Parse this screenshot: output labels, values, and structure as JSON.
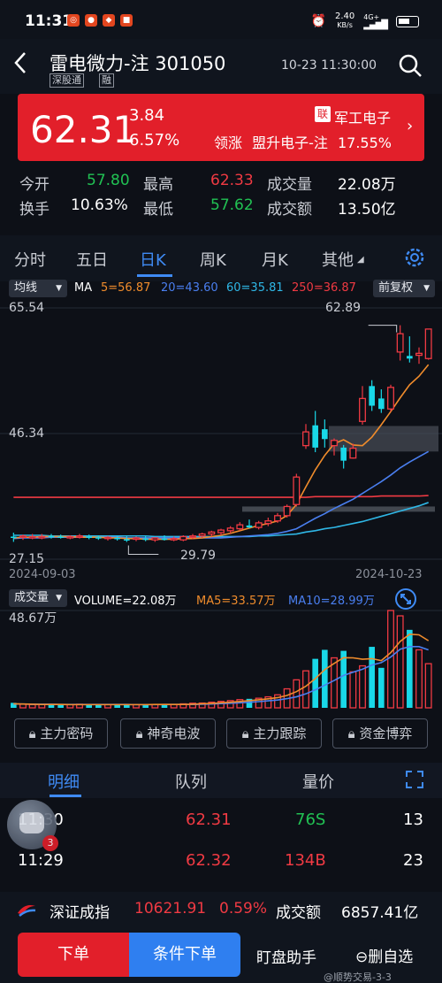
{
  "status": {
    "time": "11:31",
    "net_speed": "2.40",
    "net_unit": "KB/s",
    "net_type": "4G+"
  },
  "header": {
    "title": "雷电微力-注 301050",
    "tag1": "深股通",
    "tag2": "融",
    "datetime": "10-23 11:30:00"
  },
  "quote": {
    "price": "62.31",
    "change": "3.84",
    "change_pct": "6.57%",
    "lian": "联",
    "sector": "军工电子",
    "leader_label": "领涨",
    "leader_name": "盟升电子-注",
    "leader_pct": "17.55%"
  },
  "stats": {
    "open_label": "今开",
    "open": "57.80",
    "high_label": "最高",
    "high": "62.33",
    "vol_label": "成交量",
    "vol": "22.08万",
    "turnover_label": "换手",
    "turnover": "10.63%",
    "low_label": "最低",
    "low": "57.62",
    "amount_label": "成交额",
    "amount": "13.50亿"
  },
  "tabs": [
    "分时",
    "五日",
    "日K",
    "周K",
    "月K",
    "其他"
  ],
  "chart_bar": {
    "ma_select": "均线",
    "ma_label": "MA",
    "ma5": "5=56.87",
    "ma20": "20=43.60",
    "ma60": "60=35.81",
    "ma250": "250=36.87",
    "adjust": "前复权"
  },
  "kline": {
    "max_label": "65.54",
    "mid_label": "46.34",
    "min_label": "27.15",
    "high_marker": "62.89",
    "low_marker": "29.79",
    "date_start": "2024-09-03",
    "date_end": "2024-10-23"
  },
  "volume": {
    "select": "成交量",
    "volume_text": "VOLUME=22.08万",
    "ma5": "MA5=33.57万",
    "ma10": "MA10=28.99万",
    "max_label": "48.67万"
  },
  "tools": [
    "主力密码",
    "神奇电波",
    "主力跟踪",
    "资金博弈"
  ],
  "detail_tabs": [
    "明细",
    "队列",
    "量价"
  ],
  "detail_rows": [
    {
      "time": "11:30",
      "price": "62.31",
      "vol": "76S",
      "count": "13"
    },
    {
      "time": "11:29",
      "price": "62.32",
      "vol": "134B",
      "count": "23"
    }
  ],
  "badge": "3",
  "index": {
    "name": "深证成指",
    "value": "10621.91",
    "pct": "0.59%",
    "amount_label": "成交额",
    "amount": "6857.41亿"
  },
  "bottom": {
    "buy": "下单",
    "cond": "条件下单",
    "helper": "盯盘助手",
    "remove": "删自选"
  },
  "watermark": "@顺势交易-3-3",
  "colors": {
    "up": "#f03a43",
    "down": "#21c153",
    "accent": "#3f8bf5",
    "cyan": "#19d8e8"
  },
  "chart_data": {
    "type": "candlestick",
    "x_range": [
      "2024-09-03",
      "2024-10-23"
    ],
    "ylim": [
      27.15,
      65.54
    ],
    "annotations": {
      "high": 62.89,
      "low": 29.79
    },
    "candles": [
      {
        "o": 30.6,
        "h": 31.2,
        "l": 29.8,
        "c": 30.5
      },
      {
        "o": 30.5,
        "h": 30.9,
        "l": 30.1,
        "c": 30.7
      },
      {
        "o": 30.6,
        "h": 31.0,
        "l": 30.2,
        "c": 30.6
      },
      {
        "o": 30.6,
        "h": 31.0,
        "l": 30.2,
        "c": 30.6
      },
      {
        "o": 30.7,
        "h": 31.0,
        "l": 30.3,
        "c": 30.5
      },
      {
        "o": 30.6,
        "h": 30.9,
        "l": 30.3,
        "c": 30.4
      },
      {
        "o": 30.5,
        "h": 30.8,
        "l": 30.2,
        "c": 30.6
      },
      {
        "o": 30.6,
        "h": 31.0,
        "l": 30.3,
        "c": 30.7
      },
      {
        "o": 30.6,
        "h": 30.9,
        "l": 30.2,
        "c": 30.4
      },
      {
        "o": 30.5,
        "h": 30.8,
        "l": 30.1,
        "c": 30.3
      },
      {
        "o": 30.4,
        "h": 30.7,
        "l": 30.0,
        "c": 30.5
      },
      {
        "o": 30.4,
        "h": 30.7,
        "l": 30.0,
        "c": 30.2
      },
      {
        "o": 30.2,
        "h": 30.6,
        "l": 29.79,
        "c": 30.0
      },
      {
        "o": 30.2,
        "h": 30.6,
        "l": 29.9,
        "c": 30.4
      },
      {
        "o": 30.3,
        "h": 30.7,
        "l": 29.9,
        "c": 30.1
      },
      {
        "o": 30.1,
        "h": 30.5,
        "l": 29.8,
        "c": 30.4
      },
      {
        "o": 30.3,
        "h": 30.8,
        "l": 30.0,
        "c": 30.1
      },
      {
        "o": 30.2,
        "h": 30.6,
        "l": 29.9,
        "c": 30.3
      },
      {
        "o": 30.1,
        "h": 30.8,
        "l": 29.9,
        "c": 30.6
      },
      {
        "o": 30.5,
        "h": 31.0,
        "l": 30.2,
        "c": 30.7
      },
      {
        "o": 30.7,
        "h": 31.2,
        "l": 30.4,
        "c": 31.0
      },
      {
        "o": 31.0,
        "h": 31.5,
        "l": 30.6,
        "c": 31.3
      },
      {
        "o": 31.2,
        "h": 31.8,
        "l": 30.8,
        "c": 31.6
      },
      {
        "o": 31.5,
        "h": 32.2,
        "l": 31.1,
        "c": 31.9
      },
      {
        "o": 31.8,
        "h": 32.8,
        "l": 31.5,
        "c": 32.4
      },
      {
        "o": 32.3,
        "h": 33.2,
        "l": 31.9,
        "c": 32.0
      },
      {
        "o": 32.0,
        "h": 33.0,
        "l": 31.7,
        "c": 32.7
      },
      {
        "o": 32.6,
        "h": 33.5,
        "l": 32.2,
        "c": 33.0
      },
      {
        "o": 33.0,
        "h": 34.2,
        "l": 32.7,
        "c": 33.8
      },
      {
        "o": 33.8,
        "h": 35.5,
        "l": 33.5,
        "c": 35.2
      },
      {
        "o": 35.5,
        "h": 40.2,
        "l": 35.2,
        "c": 39.7
      },
      {
        "o": 44.5,
        "h": 47.8,
        "l": 44.0,
        "c": 46.6
      },
      {
        "o": 47.6,
        "h": 49.8,
        "l": 43.5,
        "c": 44.2
      },
      {
        "o": 47.0,
        "h": 48.5,
        "l": 44.2,
        "c": 45.5
      },
      {
        "o": 44.5,
        "h": 45.6,
        "l": 43.0,
        "c": 45.3
      },
      {
        "o": 44.2,
        "h": 44.6,
        "l": 41.0,
        "c": 42.2
      },
      {
        "o": 42.6,
        "h": 44.8,
        "l": 42.5,
        "c": 44.1
      },
      {
        "o": 48.2,
        "h": 53.6,
        "l": 47.7,
        "c": 51.7
      },
      {
        "o": 53.6,
        "h": 54.5,
        "l": 49.8,
        "c": 50.6
      },
      {
        "o": 51.7,
        "h": 53.1,
        "l": 49.5,
        "c": 50.1
      },
      {
        "o": 50.1,
        "h": 53.8,
        "l": 49.7,
        "c": 53.4
      },
      {
        "o": 58.8,
        "h": 62.89,
        "l": 57.5,
        "c": 61.6
      },
      {
        "o": 58.2,
        "h": 61.2,
        "l": 57.2,
        "c": 57.8
      },
      {
        "o": 58.3,
        "h": 59.5,
        "l": 57.0,
        "c": 58.6
      },
      {
        "o": 57.8,
        "h": 62.33,
        "l": 57.62,
        "c": 62.31
      }
    ],
    "ma5": [
      30.4,
      30.5,
      30.5,
      30.6,
      30.6,
      30.6,
      30.6,
      30.5,
      30.5,
      30.5,
      30.4,
      30.4,
      30.3,
      30.3,
      30.2,
      30.2,
      30.2,
      30.2,
      30.3,
      30.3,
      30.4,
      30.6,
      30.8,
      31.1,
      31.5,
      31.9,
      32.3,
      32.6,
      33.0,
      33.8,
      35.5,
      38.2,
      40.8,
      43.0,
      44.8,
      45.4,
      44.6,
      44.5,
      45.8,
      47.7,
      49.7,
      51.8,
      53.8,
      55.1,
      56.87
    ],
    "ma20": [
      30.3,
      30.4,
      30.4,
      30.4,
      30.5,
      30.5,
      30.5,
      30.5,
      30.5,
      30.5,
      30.5,
      30.5,
      30.4,
      30.4,
      30.4,
      30.4,
      30.4,
      30.4,
      30.4,
      30.4,
      30.4,
      30.4,
      30.4,
      30.5,
      30.6,
      30.7,
      30.8,
      30.9,
      31.1,
      31.4,
      31.8,
      32.6,
      33.4,
      34.1,
      34.9,
      35.6,
      36.3,
      37.2,
      38.1,
      39.0,
      40.0,
      41.1,
      42.0,
      42.8,
      43.6
    ],
    "ma60": [
      30.8,
      30.8,
      30.8,
      30.8,
      30.7,
      30.7,
      30.7,
      30.7,
      30.7,
      30.7,
      30.7,
      30.7,
      30.7,
      30.7,
      30.7,
      30.6,
      30.6,
      30.6,
      30.6,
      30.6,
      30.6,
      30.6,
      30.6,
      30.6,
      30.6,
      30.6,
      30.7,
      30.7,
      30.8,
      30.9,
      31.0,
      31.3,
      31.5,
      31.8,
      32.0,
      32.3,
      32.6,
      32.9,
      33.3,
      33.7,
      34.1,
      34.5,
      34.9,
      35.3,
      35.81
    ],
    "ma250": [
      36.6,
      36.6,
      36.6,
      36.6,
      36.6,
      36.6,
      36.6,
      36.6,
      36.6,
      36.6,
      36.6,
      36.6,
      36.6,
      36.6,
      36.6,
      36.6,
      36.6,
      36.6,
      36.6,
      36.6,
      36.6,
      36.6,
      36.6,
      36.6,
      36.6,
      36.6,
      36.6,
      36.6,
      36.6,
      36.6,
      36.6,
      36.6,
      36.7,
      36.7,
      36.7,
      36.7,
      36.7,
      36.7,
      36.7,
      36.8,
      36.8,
      36.8,
      36.8,
      36.8,
      36.87
    ],
    "volume_ylim": [
      0,
      48.67
    ],
    "volume": [
      2.5,
      1.8,
      1.6,
      1.7,
      1.9,
      1.5,
      1.6,
      1.8,
      1.4,
      1.5,
      1.6,
      1.7,
      2.0,
      1.6,
      1.5,
      1.7,
      1.8,
      1.6,
      2.0,
      2.3,
      2.4,
      2.8,
      3.2,
      3.6,
      4.1,
      4.5,
      4.8,
      5.5,
      6.5,
      9.5,
      14.0,
      18.5,
      24.5,
      29.0,
      25.0,
      28.5,
      18.0,
      21.0,
      30.5,
      20.0,
      48.67,
      46.0,
      39.0,
      29.0,
      22.08
    ],
    "vol_ma5": [
      2.0,
      1.9,
      1.8,
      1.7,
      1.7,
      1.7,
      1.6,
      1.6,
      1.6,
      1.6,
      1.6,
      1.6,
      1.6,
      1.6,
      1.6,
      1.7,
      1.7,
      1.7,
      1.7,
      1.8,
      2.0,
      2.2,
      2.5,
      2.8,
      3.2,
      3.6,
      4.0,
      4.5,
      5.1,
      6.2,
      8.1,
      10.8,
      14.6,
      19.1,
      22.2,
      25.1,
      25.0,
      24.3,
      24.6,
      23.6,
      27.6,
      33.2,
      36.8,
      36.5,
      33.57
    ],
    "vol_ma10": [
      1.9,
      1.9,
      1.8,
      1.8,
      1.8,
      1.7,
      1.7,
      1.7,
      1.7,
      1.7,
      1.7,
      1.7,
      1.7,
      1.6,
      1.6,
      1.6,
      1.7,
      1.7,
      1.7,
      1.7,
      1.8,
      1.9,
      2.1,
      2.3,
      2.5,
      2.8,
      3.1,
      3.5,
      3.9,
      4.6,
      5.5,
      7.0,
      9.0,
      11.3,
      13.7,
      16.2,
      17.8,
      19.3,
      21.4,
      22.6,
      25.4,
      29.3,
      30.6,
      30.6,
      28.99
    ]
  }
}
